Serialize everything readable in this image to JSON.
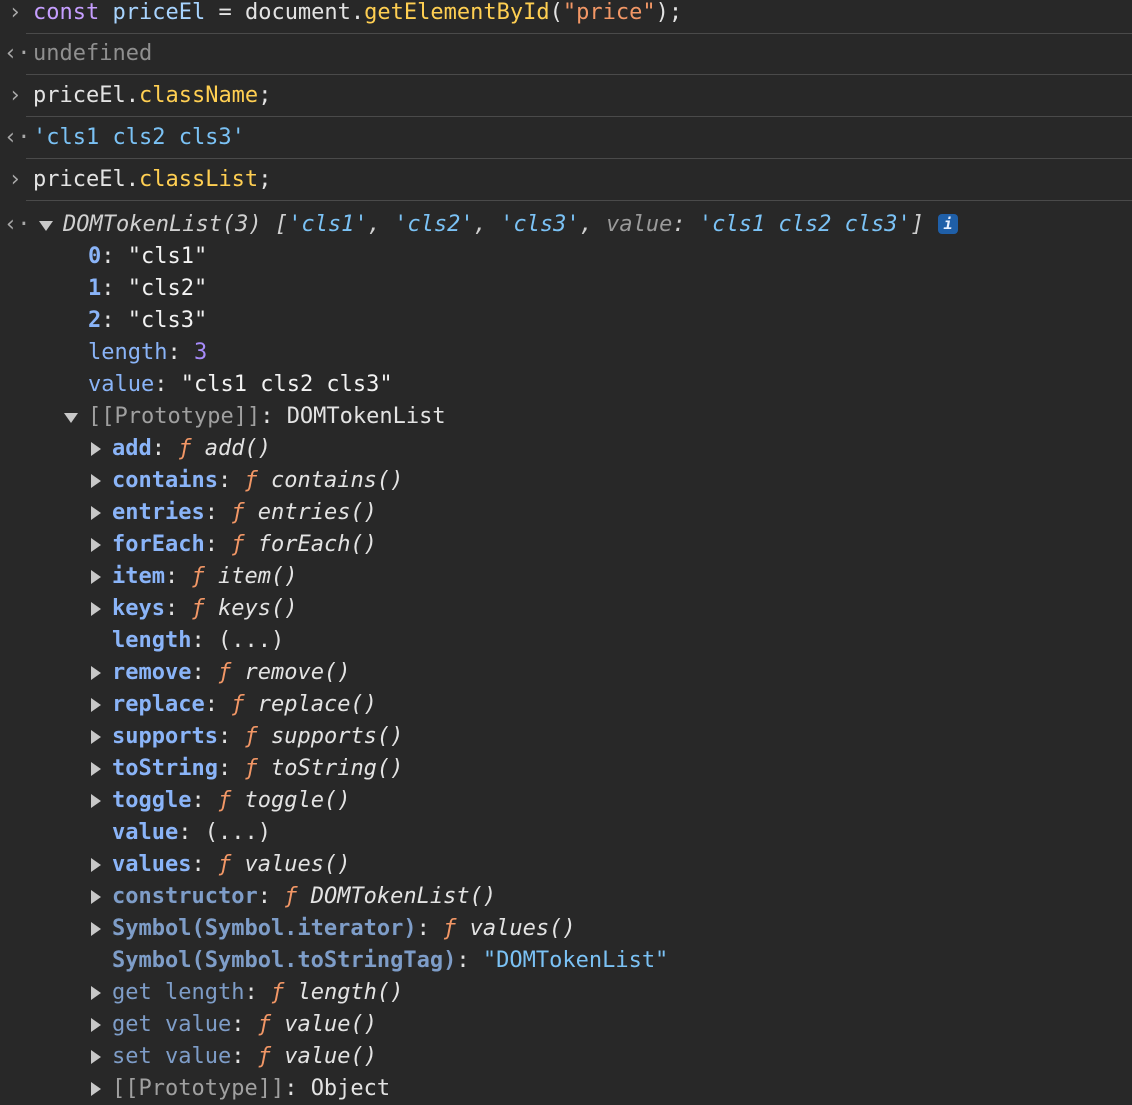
{
  "console": {
    "input1": {
      "keyword": "const",
      "var": "priceEl",
      "eq": " = ",
      "obj": "document.",
      "method": "getElementById",
      "open": "(",
      "arg": "\"price\"",
      "close": ");"
    },
    "output1": "undefined",
    "input2": {
      "obj": "priceEl.",
      "prop": "className",
      "end": ";"
    },
    "output2": "'cls1 cls2 cls3'",
    "input3": {
      "obj": "priceEl.",
      "prop": "classList",
      "end": ";"
    },
    "output3": {
      "type": "DOMTokenList(3)",
      "open": " [",
      "item1": "'cls1'",
      "item2": "'cls2'",
      "item3": "'cls3'",
      "comma": ", ",
      "value_key": "value",
      "colon": ": ",
      "value_str": "'cls1 cls2 cls3'",
      "close": "]",
      "info": "i"
    },
    "expanded": {
      "items": [
        {
          "key": "0",
          "value": "\"cls1\""
        },
        {
          "key": "1",
          "value": "\"cls2\""
        },
        {
          "key": "2",
          "value": "\"cls3\""
        }
      ],
      "length_key": "length",
      "length_val": "3",
      "value_key": "value",
      "value_val": "\"cls1 cls2 cls3\"",
      "proto_key": "[[Prototype]]",
      "proto_val": "DOMTokenList"
    },
    "prototype_members": [
      {
        "key": "add",
        "kind": "fn",
        "name": "add()"
      },
      {
        "key": "contains",
        "kind": "fn",
        "name": "contains()"
      },
      {
        "key": "entries",
        "kind": "fn",
        "name": "entries()"
      },
      {
        "key": "forEach",
        "kind": "fn",
        "name": "forEach()"
      },
      {
        "key": "item",
        "kind": "fn",
        "name": "item()"
      },
      {
        "key": "keys",
        "kind": "fn",
        "name": "keys()"
      },
      {
        "key": "length",
        "kind": "getter",
        "name": "(...)"
      },
      {
        "key": "remove",
        "kind": "fn",
        "name": "remove()"
      },
      {
        "key": "replace",
        "kind": "fn",
        "name": "replace()"
      },
      {
        "key": "supports",
        "kind": "fn",
        "name": "supports()"
      },
      {
        "key": "toString",
        "kind": "fn",
        "name": "toString()"
      },
      {
        "key": "toggle",
        "kind": "fn",
        "name": "toggle()"
      },
      {
        "key": "value",
        "kind": "getter",
        "name": "(...)"
      },
      {
        "key": "values",
        "kind": "fn",
        "name": "values()"
      },
      {
        "key": "constructor",
        "kind": "fn-dim",
        "name": "DOMTokenList()"
      },
      {
        "key": "Symbol(Symbol.iterator)",
        "kind": "fn-dim",
        "name": "values()"
      },
      {
        "key": "Symbol(Symbol.toStringTag)",
        "kind": "str-dim",
        "name": "\"DOMTokenList\""
      },
      {
        "key": "get length",
        "kind": "fn-dim",
        "name": "length()"
      },
      {
        "key": "get value",
        "kind": "fn-dim",
        "name": "value()"
      },
      {
        "key": "set value",
        "kind": "fn-dim",
        "name": "value()"
      },
      {
        "key": "[[Prototype]]",
        "kind": "obj",
        "name": "Object"
      }
    ],
    "f_glyph": "ƒ",
    "colon": ": ",
    "prompt_in": "›",
    "prompt_out": "‹·"
  }
}
